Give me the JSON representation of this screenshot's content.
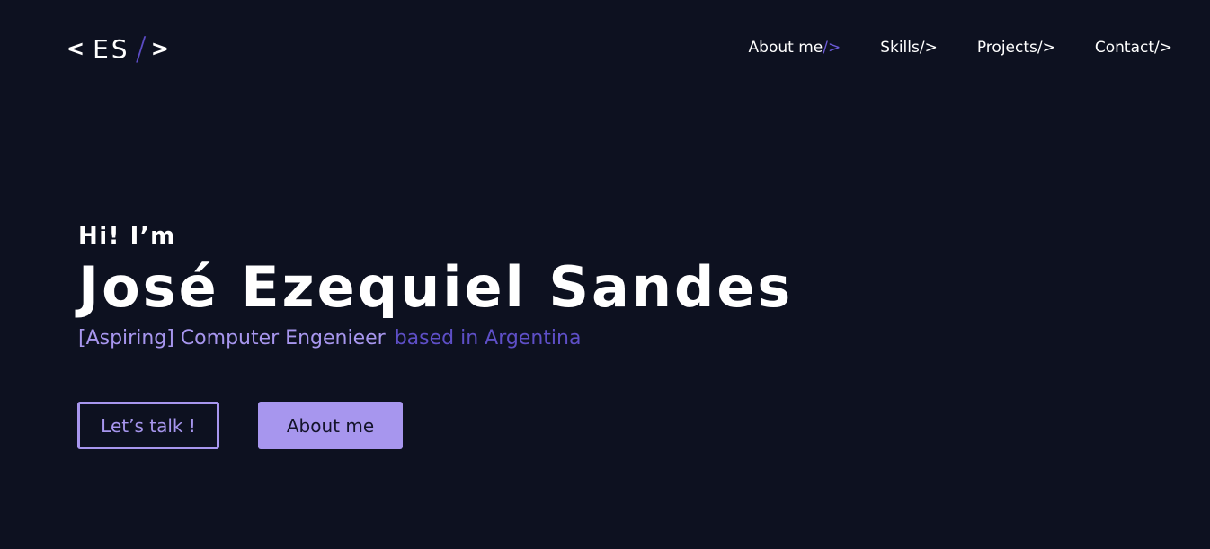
{
  "logo": {
    "open": "<",
    "letters": "ES",
    "slash": "/",
    "close": ">"
  },
  "nav": {
    "items": [
      {
        "label": "About me",
        "suffix": "/>"
      },
      {
        "label": "Skills",
        "suffix": "/>"
      },
      {
        "label": "Projects",
        "suffix": "/>"
      },
      {
        "label": "Contact",
        "suffix": "/>"
      }
    ]
  },
  "hero": {
    "greeting": "Hi! I’m",
    "name": "José Ezequiel Sandes",
    "role": "[Aspiring] Computer Engenieer",
    "location": "based in Argentina"
  },
  "buttons": {
    "talk": "Let’s talk !",
    "about": "About me"
  },
  "colors": {
    "background": "#0d1120",
    "accent": "#a796ee",
    "accent_dark": "#5e4fc7"
  }
}
